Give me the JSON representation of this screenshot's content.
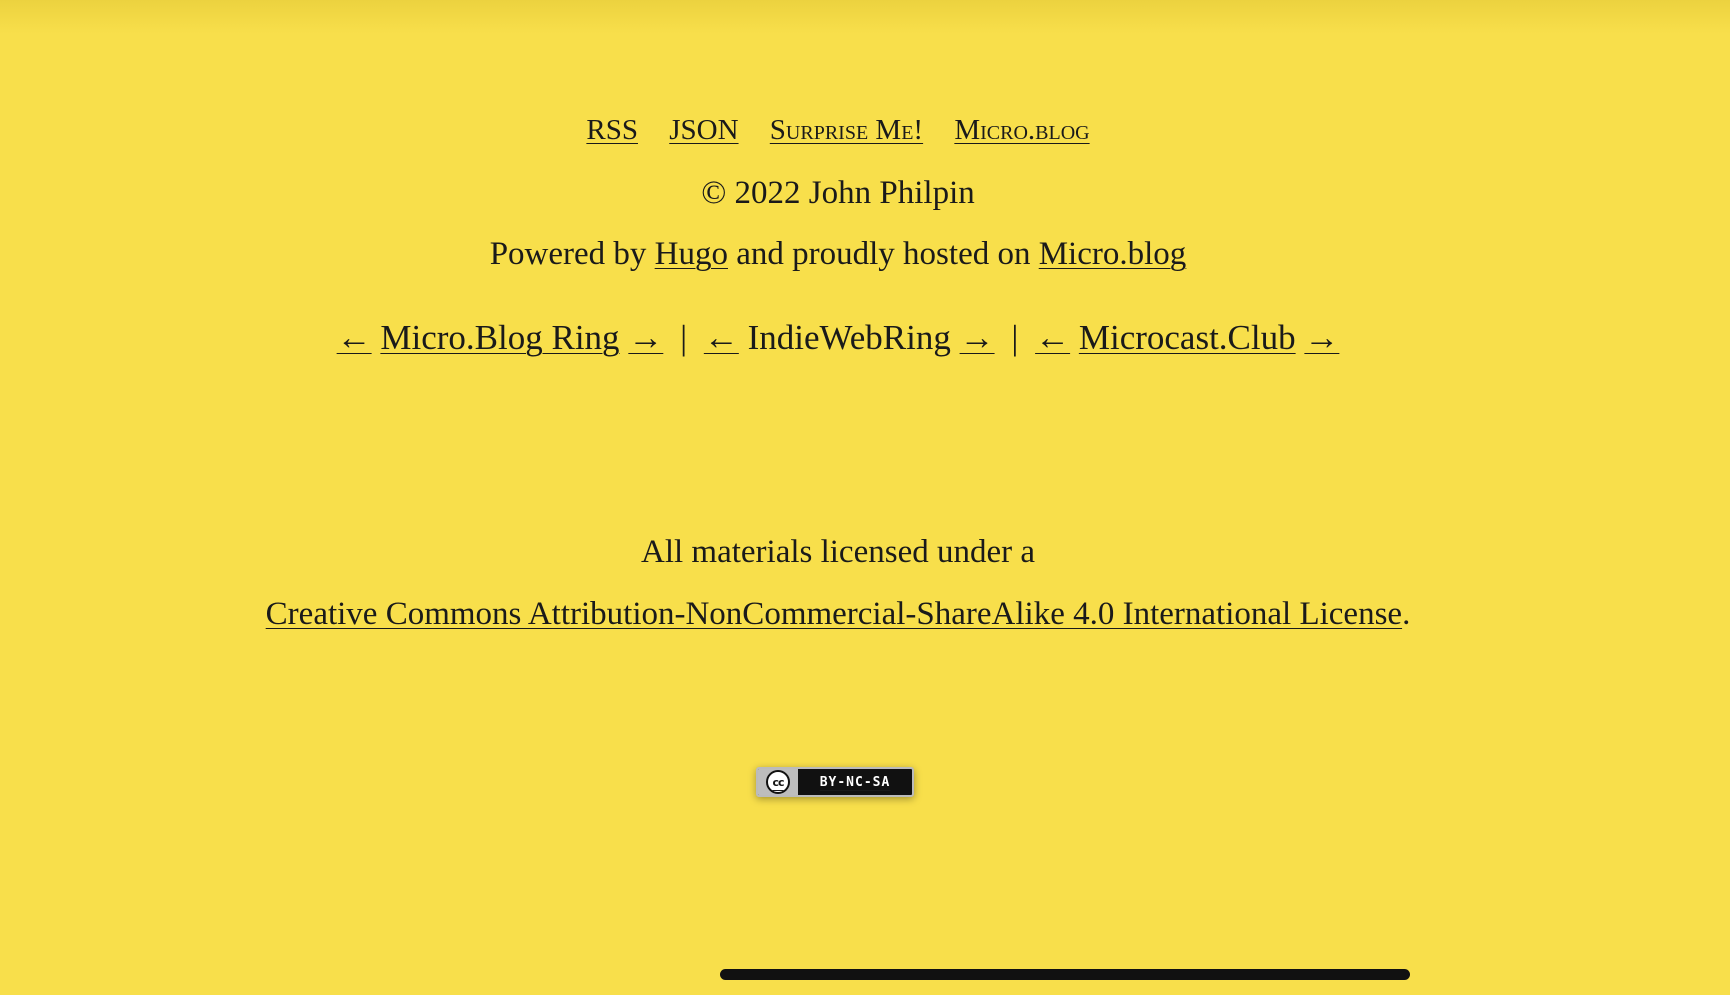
{
  "nav": {
    "rss": "RSS",
    "json": "JSON",
    "surprise": "Surprise Me!",
    "microblog": "Micro.blog"
  },
  "footer": {
    "copyright": "© 2022 John Philpin",
    "powered_prefix": "Powered by ",
    "hugo": "Hugo",
    "hosted_text": " and proudly hosted on ",
    "microblog": "Micro.blog"
  },
  "rings": {
    "prev_arrow": "←",
    "next_arrow": "→",
    "separator": "|",
    "microblog_ring": "Micro.Blog Ring",
    "indieweb_ring": "IndieWebRing",
    "microcast_club": "Microcast.Club"
  },
  "license": {
    "intro": "All materials licensed under a",
    "link": "Creative Commons Attribution-NonCommercial-ShareAlike 4.0 International License",
    "period": ".",
    "badge_cc": "cc",
    "badge_terms": "BY-NC-SA"
  },
  "colors": {
    "background": "#f8df4b",
    "text": "#1a1a1a"
  }
}
